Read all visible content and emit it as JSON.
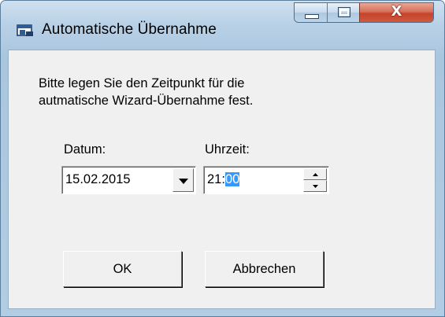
{
  "window": {
    "title": "Automatische Übernahme",
    "app_icon": "window-app-icon",
    "caption_buttons": {
      "minimize_icon": "minimize-icon",
      "maximize_icon": "maximize-icon",
      "close_glyph": "X",
      "close_color": "#c5432b"
    }
  },
  "message": {
    "line1": "Bitte legen Sie den Zeitpunkt für die",
    "line2": "autmatische Wizard-Übernahme fest."
  },
  "date": {
    "label": "Datum:",
    "value": "15.02.2015",
    "dropdown_icon": "chevron-down-icon"
  },
  "time": {
    "label": "Uhrzeit:",
    "hour": "21",
    "separator": ":",
    "minute_selected": "00",
    "selection_color": "#3399ff",
    "spin_up_icon": "arrow-up-icon",
    "spin_down_icon": "arrow-down-icon"
  },
  "buttons": {
    "ok_label": "OK",
    "cancel_label": "Abbrechen"
  }
}
